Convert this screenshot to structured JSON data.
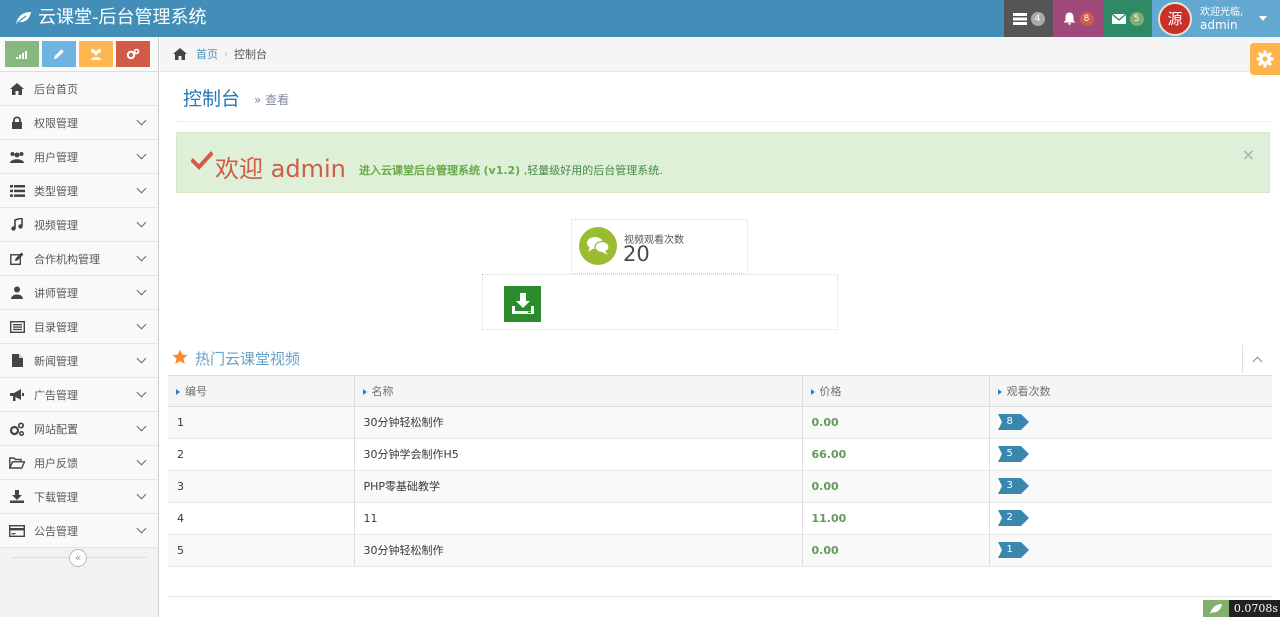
{
  "app": {
    "title": "云课堂-后台管理系统"
  },
  "navbar": {
    "tasks_count": "4",
    "notifications_count": "8",
    "messages_count": "5",
    "avatar_text": "源",
    "greeting": "欢迎光临,",
    "username": "admin"
  },
  "sidebar": {
    "items": [
      {
        "label": "后台首页",
        "icon": "home-icon"
      },
      {
        "label": "权限管理",
        "icon": "lock-icon"
      },
      {
        "label": "用户管理",
        "icon": "users-icon"
      },
      {
        "label": "类型管理",
        "icon": "list-icon"
      },
      {
        "label": "视频管理",
        "icon": "music-icon"
      },
      {
        "label": "合作机构管理",
        "icon": "edit-icon"
      },
      {
        "label": "讲师管理",
        "icon": "user-icon"
      },
      {
        "label": "目录管理",
        "icon": "catalog-icon"
      },
      {
        "label": "新闻管理",
        "icon": "file-icon"
      },
      {
        "label": "广告管理",
        "icon": "bullhorn-icon"
      },
      {
        "label": "网站配置",
        "icon": "cogs-icon"
      },
      {
        "label": "用户反馈",
        "icon": "folder-open-icon"
      },
      {
        "label": "下载管理",
        "icon": "download-icon"
      },
      {
        "label": "公告管理",
        "icon": "credit-card-icon"
      }
    ],
    "collapse_glyph": "«"
  },
  "breadcrumb": {
    "home": "首页",
    "sep": "›",
    "current": "控制台"
  },
  "page": {
    "title": "控制台",
    "subtitle": "» 查看"
  },
  "alert": {
    "welcome": "欢迎 admin",
    "desc_bold": "进入云课堂后台管理系统",
    "version": "(v1.2)",
    "desc_rest": " ,轻量级好用的后台管理系统.",
    "close": "×"
  },
  "infobox": {
    "label": "视频观看次数",
    "value": "20"
  },
  "widget": {
    "title": "热门云课堂视频"
  },
  "table": {
    "headers": [
      "编号",
      "名称",
      "价格",
      "观看次数"
    ],
    "rows": [
      {
        "id": "1",
        "name": "30分钟轻松制作",
        "price": "0.00",
        "views": "8"
      },
      {
        "id": "2",
        "name": "30分钟学会制作H5",
        "price": "66.00",
        "views": "5"
      },
      {
        "id": "3",
        "name": "PHP零基础教学",
        "price": "0.00",
        "views": "3"
      },
      {
        "id": "4",
        "name": "11",
        "price": "11.00",
        "views": "2"
      },
      {
        "id": "5",
        "name": "30分钟轻松制作",
        "price": "0.00",
        "views": "1"
      }
    ]
  },
  "footer": {
    "timer": "0.0708s"
  },
  "colors": {
    "navbar": "#438eb9",
    "accent_blue": "#2679b5",
    "alert_bg": "#dff0d8",
    "welcome_red": "#d15b47",
    "price_green": "#629b58",
    "badge_blue": "#3a87ad"
  }
}
